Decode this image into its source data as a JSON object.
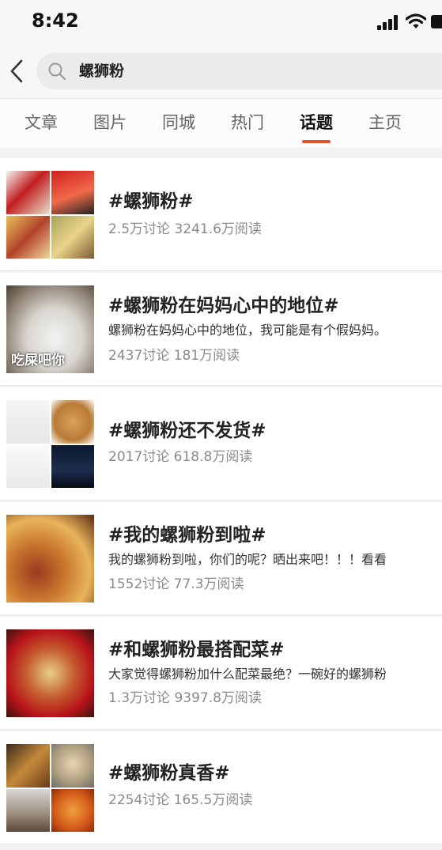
{
  "status_bar": {
    "time": "8:42"
  },
  "search": {
    "value": "螺狮粉"
  },
  "tabs": [
    {
      "label": "文章",
      "active": false
    },
    {
      "label": "图片",
      "active": false
    },
    {
      "label": "同城",
      "active": false
    },
    {
      "label": "热门",
      "active": false
    },
    {
      "label": "话题",
      "active": true
    },
    {
      "label": "主页",
      "active": false
    }
  ],
  "accent_color": "#e2512b",
  "topics": [
    {
      "title": "#螺狮粉#",
      "desc": "",
      "stats": "2.5万讨论 3241.6万阅读"
    },
    {
      "title": "#螺狮粉在妈妈心中的地位#",
      "desc": "螺狮粉在妈妈心中的地位，我可能是有个假妈妈。",
      "stats": "2437讨论 181万阅读",
      "thumb_caption": "吃屎吧你"
    },
    {
      "title": "#螺狮粉还不发货#",
      "desc": "",
      "stats": "2017讨论 618.8万阅读"
    },
    {
      "title": "#我的螺狮粉到啦#",
      "desc": "我的螺狮粉到啦，你们的呢？晒出来吧！！！看看",
      "stats": "1552讨论 77.3万阅读"
    },
    {
      "title": "#和螺狮粉最搭配菜#",
      "desc": "大家觉得螺狮粉加什么配菜最绝？一碗好的螺狮粉",
      "stats": "1.3万讨论 9397.8万阅读"
    },
    {
      "title": "#螺狮粉真香#",
      "desc": "",
      "stats": "2254讨论 165.5万阅读"
    }
  ]
}
